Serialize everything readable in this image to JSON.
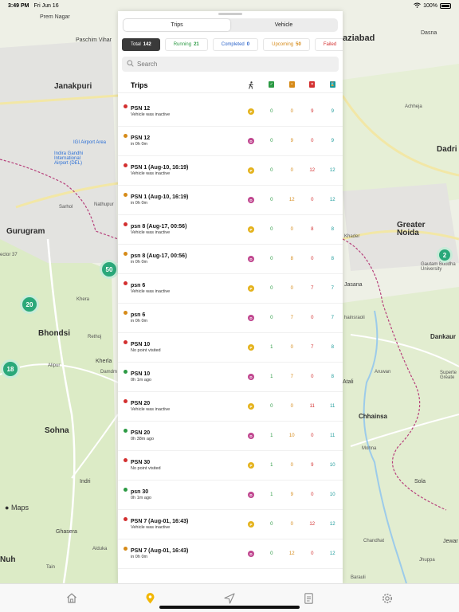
{
  "status_bar": {
    "time": "3:49 PM",
    "date": "Fri Jun 16",
    "battery": "100%"
  },
  "map": {
    "labels": {
      "janakpuri": "Janakpuri",
      "gurugram": "Gurugram",
      "bhondsi": "Bhondsi",
      "sohna": "Sohna",
      "greater_noida": "Greater Noida",
      "dadri": "Dadri",
      "dankaur": "Dankaur",
      "chhainsa": "Chhainsa",
      "jasana": "Jasana",
      "nuh": "Nuh",
      "ghasera": "Ghasera",
      "indri": "Indri",
      "ghaziabad": "aziabad",
      "dasna": "Dasna",
      "prem_nagar": "Prem Nagar",
      "paschim_vihar": "Paschim Vihar",
      "igi_airport": "IGI Airport Area",
      "airport": "Indira Gandhi International Airport (DEL)",
      "nathupur": "Nathupur",
      "khera": "Khera",
      "kherla": "Kherla",
      "rethoj": "Rethoj",
      "alipur": "Alipur",
      "atali": "Atali",
      "sector37": "ector 37",
      "gautam": "Gautam Buddha University",
      "jewar": "Jewar",
      "sola": "Sola",
      "chandhat": "Chandhat",
      "barauli": "Barauli",
      "alduka": "Alduka",
      "tain": "Tain",
      "jhuppa": "Jhuppa",
      "mohna": "Mohna",
      "aruwan": "Aruwan",
      "achheja": "Achheja",
      "khader": "Khader",
      "chainsraoli": "hainsraoli",
      "sarhol": "Sarhol",
      "damdma": "Damdm",
      "superte": "Superte Greate",
      "maps": "Maps"
    },
    "clusters": {
      "c50": "50",
      "c20": "20",
      "c18": "18",
      "c2": "2"
    }
  },
  "panel": {
    "tabs": [
      "Trips",
      "Vehicle"
    ],
    "chips": [
      {
        "label": "Total",
        "count": "142"
      },
      {
        "label": "Running",
        "count": "21"
      },
      {
        "label": "Completed",
        "count": "0"
      },
      {
        "label": "Upcoming",
        "count": "50"
      },
      {
        "label": "Failed",
        "count": ""
      }
    ],
    "search_placeholder": "Search",
    "list_title": "Trips",
    "colors": {
      "green": "#2c9a44",
      "orange": "#d68a18",
      "red": "#d32f2f",
      "teal": "#1a9a9a",
      "pickup": "#e4b21c",
      "drop": "#c0468f"
    },
    "header_icons": [
      "walking-person-icon",
      "check-flag-icon",
      "pending-flag-icon",
      "cross-flag-icon",
      "hourglass-icon"
    ],
    "trips": [
      {
        "name": "PSN 12",
        "sub": "Vehicle was inactive",
        "status": "red",
        "badge": "P",
        "c1": "0",
        "c2": "0",
        "c3": "9",
        "c4": "9"
      },
      {
        "name": "PSN 12",
        "sub": "in 0h 0m",
        "status": "orange",
        "badge": "D",
        "c1": "0",
        "c2": "9",
        "c3": "0",
        "c4": "9"
      },
      {
        "name": "PSN 1 (Aug-10, 16:19)",
        "sub": "Vehicle was inactive",
        "status": "red",
        "badge": "P",
        "c1": "0",
        "c2": "0",
        "c3": "12",
        "c4": "12"
      },
      {
        "name": "PSN 1 (Aug-10, 16:19)",
        "sub": "in 0h 0m",
        "status": "orange",
        "badge": "D",
        "c1": "0",
        "c2": "12",
        "c3": "0",
        "c4": "12"
      },
      {
        "name": "psn 8 (Aug-17, 00:56)",
        "sub": "Vehicle was inactive",
        "status": "red",
        "badge": "P",
        "c1": "0",
        "c2": "0",
        "c3": "8",
        "c4": "8"
      },
      {
        "name": "psn 8 (Aug-17, 00:56)",
        "sub": "in 0h 0m",
        "status": "orange",
        "badge": "D",
        "c1": "0",
        "c2": "8",
        "c3": "0",
        "c4": "8"
      },
      {
        "name": "psn 6",
        "sub": "Vehicle was inactive",
        "status": "red",
        "badge": "P",
        "c1": "0",
        "c2": "0",
        "c3": "7",
        "c4": "7"
      },
      {
        "name": "psn 6",
        "sub": "in 0h 0m",
        "status": "orange",
        "badge": "D",
        "c1": "0",
        "c2": "7",
        "c3": "0",
        "c4": "7"
      },
      {
        "name": "PSN 10",
        "sub": "No point visited",
        "status": "red",
        "badge": "P",
        "c1": "1",
        "c2": "0",
        "c3": "7",
        "c4": "8"
      },
      {
        "name": "PSN 10",
        "sub": "0h 1m ago",
        "status": "green",
        "badge": "D",
        "c1": "1",
        "c2": "7",
        "c3": "0",
        "c4": "8"
      },
      {
        "name": "PSN 20",
        "sub": "Vehicle was inactive",
        "status": "red",
        "badge": "P",
        "c1": "0",
        "c2": "0",
        "c3": "11",
        "c4": "11"
      },
      {
        "name": "PSN 20",
        "sub": "0h 38m ago",
        "status": "green",
        "badge": "D",
        "c1": "1",
        "c2": "10",
        "c3": "0",
        "c4": "11"
      },
      {
        "name": "PSN 30",
        "sub": "No point visited",
        "status": "red",
        "badge": "P",
        "c1": "1",
        "c2": "0",
        "c3": "9",
        "c4": "10"
      },
      {
        "name": "psn 30",
        "sub": "0h 1m ago",
        "status": "green",
        "badge": "D",
        "c1": "1",
        "c2": "9",
        "c3": "0",
        "c4": "10"
      },
      {
        "name": "PSN 7 (Aug-01, 16:43)",
        "sub": "Vehicle was inactive",
        "status": "red",
        "badge": "P",
        "c1": "0",
        "c2": "0",
        "c3": "12",
        "c4": "12"
      },
      {
        "name": "PSN 7 (Aug-01, 16:43)",
        "sub": "in 0h 0m",
        "status": "orange",
        "badge": "D",
        "c1": "0",
        "c2": "12",
        "c3": "0",
        "c4": "12"
      }
    ]
  },
  "tabbar": {
    "items": [
      "home-icon",
      "location-pin-icon",
      "navigation-arrow-icon",
      "document-icon",
      "settings-icon"
    ],
    "active_color": "#f2b705"
  }
}
